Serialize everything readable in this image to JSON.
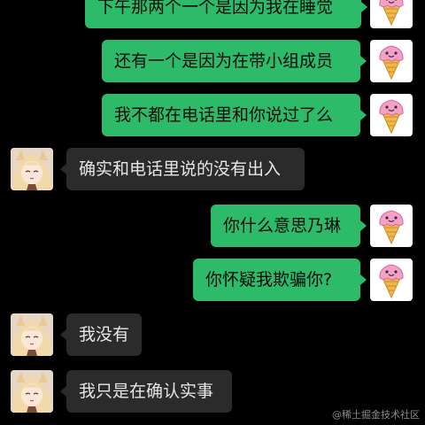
{
  "messages": [
    {
      "sender": "me",
      "text": "下午那两个一个是因为我在睡觉"
    },
    {
      "sender": "me",
      "text": "还有一个是因为在带小组成员"
    },
    {
      "sender": "me",
      "text": "我不都在电话里和你说过了么"
    },
    {
      "sender": "other",
      "text": "确实和电话里说的没有出入"
    },
    {
      "sender": "me",
      "text": "你什么意思乃琳"
    },
    {
      "sender": "me",
      "text": "你怀疑我欺骗你?"
    },
    {
      "sender": "other",
      "text": "我没有"
    },
    {
      "sender": "other",
      "text": "我只是在确认实事"
    }
  ],
  "watermark": "@稀土掘金技术社区",
  "colors": {
    "background": "#000000",
    "my_bubble": "#2dbb6a",
    "other_bubble": "#2b2b2b",
    "other_text": "#e6e6e6"
  },
  "icons": {
    "my_avatar": "ice-cream-cone-icon",
    "other_avatar": "anime-girl-avatar"
  }
}
